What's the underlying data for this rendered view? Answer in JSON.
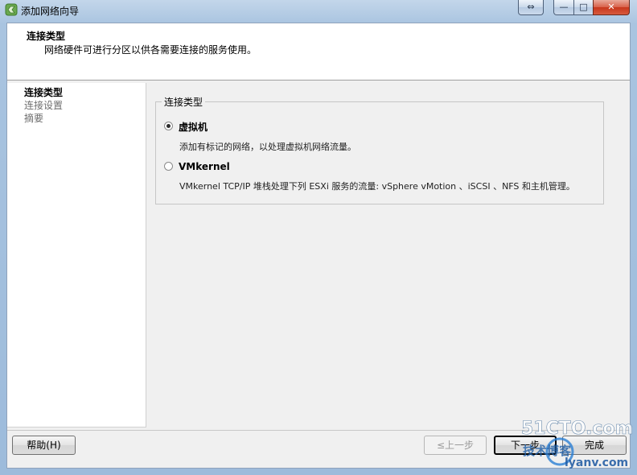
{
  "window": {
    "title": "添加网络向导",
    "controls": {
      "swap": "⇔",
      "minimize": "—",
      "maximize": "□",
      "close": "✕"
    }
  },
  "header": {
    "title": "连接类型",
    "description": "网络硬件可进行分区以供各需要连接的服务使用。"
  },
  "nav": {
    "items": [
      {
        "label": "连接类型",
        "active": true
      },
      {
        "label": "连接设置",
        "active": false
      },
      {
        "label": "摘要",
        "active": false
      }
    ]
  },
  "group": {
    "legend": "连接类型",
    "options": [
      {
        "label": "虚拟机",
        "description": "添加有标记的网络，以处理虚拟机网络流量。",
        "selected": true
      },
      {
        "label": "VMkernel",
        "description": "VMkernel TCP/IP 堆栈处理下列 ESXi 服务的流量: vSphere vMotion 、iSCSI 、NFS 和主机管理。",
        "selected": false
      }
    ]
  },
  "footer": {
    "help_label": "帮助(H)",
    "back_label": "≤上一步",
    "next_label": "下一步",
    "finish_label": "完成"
  },
  "watermark": {
    "line1": "51CTO.com",
    "line2": "技术博客",
    "line3": "lyanv.com"
  }
}
